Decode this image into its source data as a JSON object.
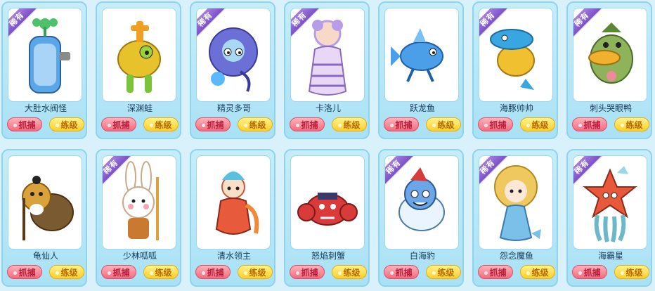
{
  "buttons": {
    "catch": "抓捕",
    "train": "练级"
  },
  "rare_label": "稀有",
  "pets": [
    {
      "name": "大肚水阀怪",
      "rare": true,
      "icon": "water-tap-creature-icon",
      "color": "#5aa7e8"
    },
    {
      "name": "深渊蛙",
      "rare": false,
      "icon": "frog-creature-icon",
      "color": "#e8c22b"
    },
    {
      "name": "精灵多哥",
      "rare": true,
      "icon": "elf-creature-icon",
      "color": "#6b6fd6"
    },
    {
      "name": "卡洛儿",
      "rare": true,
      "icon": "mermaid-creature-icon",
      "color": "#b79de8"
    },
    {
      "name": "跃龙鱼",
      "rare": false,
      "icon": "dragon-fish-icon",
      "color": "#4b9fe8"
    },
    {
      "name": "海豚帅帅",
      "rare": true,
      "icon": "dolphin-creature-icon",
      "color": "#38a6e0"
    },
    {
      "name": "刺头哭眼鸭",
      "rare": true,
      "icon": "duck-creature-icon",
      "color": "#8fb35a"
    },
    {
      "name": "龟仙人",
      "rare": false,
      "icon": "turtle-sage-icon",
      "color": "#d9a23a"
    },
    {
      "name": "少林呱呱",
      "rare": true,
      "icon": "rabbit-monk-icon",
      "color": "#f5eada"
    },
    {
      "name": "清水领主",
      "rare": false,
      "icon": "water-lord-icon",
      "color": "#e85a3c"
    },
    {
      "name": "怒焰刺蟹",
      "rare": false,
      "icon": "crab-creature-icon",
      "color": "#d93a3a"
    },
    {
      "name": "白海豹",
      "rare": true,
      "icon": "seal-creature-icon",
      "color": "#6aa6e8"
    },
    {
      "name": "怨念魔鱼",
      "rare": true,
      "icon": "mermaid-girl-icon",
      "color": "#f0c860"
    },
    {
      "name": "海霸星",
      "rare": true,
      "icon": "starfish-creature-icon",
      "color": "#e8593c"
    }
  ]
}
